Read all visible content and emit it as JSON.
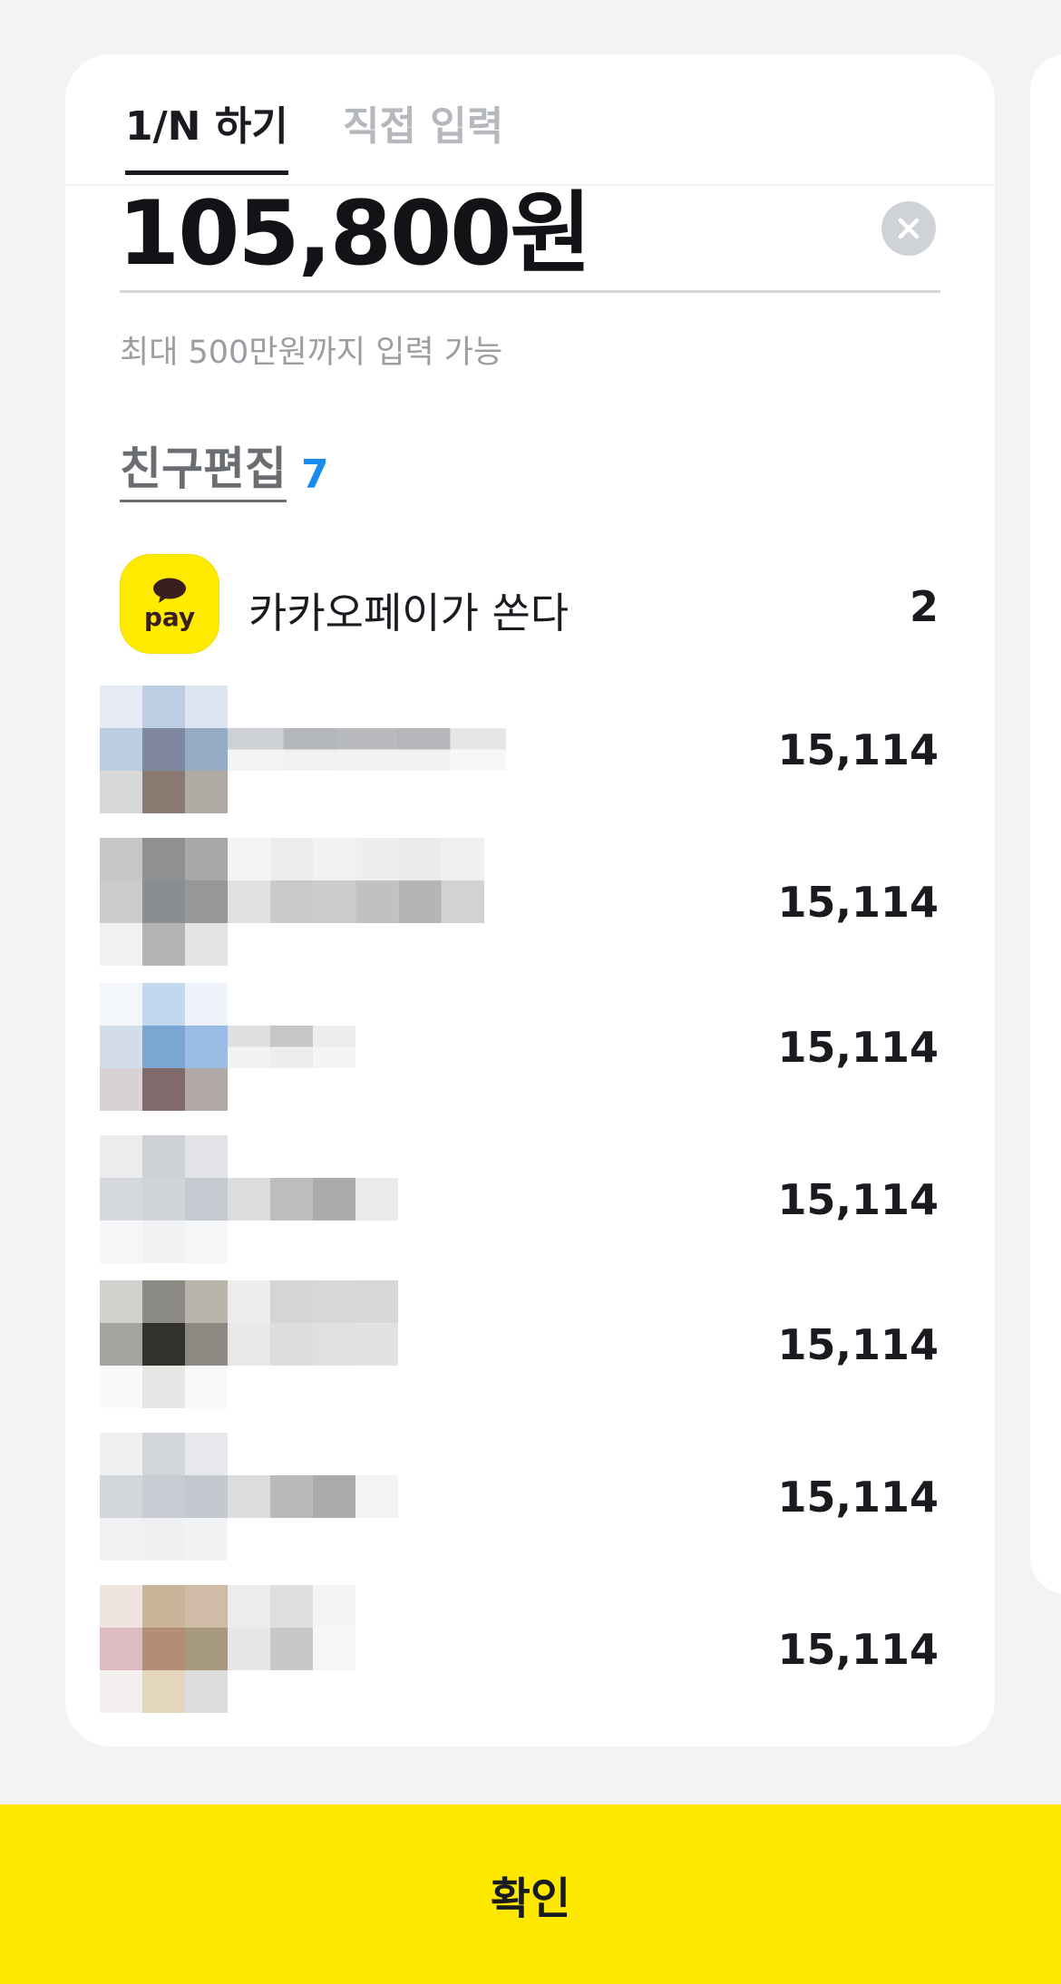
{
  "tabs": [
    {
      "label": "1/N 하기",
      "active": true
    },
    {
      "label": "직접 입력",
      "active": false
    }
  ],
  "amount": {
    "value": "105,800원",
    "hint": "최대 500만원까지 입력 가능",
    "clear_icon": "close-circle-icon"
  },
  "friends": {
    "edit_label": "친구편집",
    "count": "7"
  },
  "pay_row": {
    "logo_text": "pay",
    "name": "카카오페이가 쏜다",
    "amount": "2"
  },
  "members": [
    {
      "share": "15,114"
    },
    {
      "share": "15,114"
    },
    {
      "share": "15,114"
    },
    {
      "share": "15,114"
    },
    {
      "share": "15,114"
    },
    {
      "share": "15,114"
    },
    {
      "share": "15,114"
    }
  ],
  "confirm_label": "확인",
  "colors": {
    "accent_yellow": "#ffe800",
    "count_blue": "#1a8cf0",
    "background": "#f2f3f5",
    "text": "#191b20",
    "muted": "#9a9da2"
  }
}
